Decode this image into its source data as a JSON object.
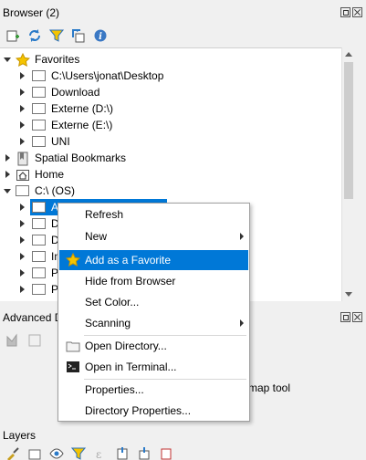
{
  "browser_panel": {
    "title": "Browser (2)",
    "toolbar_icons": [
      "add-layer-icon",
      "refresh-icon",
      "filter-icon",
      "collapse-icon",
      "info-icon"
    ],
    "tree": [
      {
        "label": "Favorites",
        "icon": "star-icon",
        "expanded": true,
        "level": 0
      },
      {
        "label": "C:\\Users\\jonat\\Desktop",
        "icon": "folder-icon",
        "level": 1
      },
      {
        "label": "Download",
        "icon": "folder-icon",
        "level": 1
      },
      {
        "label": "Externe (D:\\)",
        "icon": "folder-icon",
        "level": 1
      },
      {
        "label": "Externe (E:\\)",
        "icon": "folder-icon",
        "level": 1
      },
      {
        "label": "UNI",
        "icon": "folder-icon",
        "level": 1
      },
      {
        "label": "Spatial Bookmarks",
        "icon": "bookmark-icon",
        "level": 0
      },
      {
        "label": "Home",
        "icon": "home-icon",
        "level": 0
      },
      {
        "label": "C:\\ (OS)",
        "icon": "drive-icon",
        "expanded": true,
        "level": 0
      },
      {
        "label": "A",
        "icon": "folder-icon",
        "level": 1,
        "selected": true
      },
      {
        "label": "D",
        "icon": "folder-icon",
        "level": 1
      },
      {
        "label": "D",
        "icon": "folder-icon",
        "level": 1
      },
      {
        "label": "In",
        "icon": "folder-icon",
        "level": 1
      },
      {
        "label": "P",
        "icon": "folder-icon",
        "level": 1
      },
      {
        "label": "P",
        "icon": "folder-icon",
        "level": 1
      }
    ]
  },
  "advanced_panel": {
    "title": "Advanced D",
    "partial_text": "map tool"
  },
  "layers_panel": {
    "title": "Layers"
  },
  "context_menu": {
    "items": [
      {
        "label": "Refresh"
      },
      {
        "label": "New",
        "submenu": true
      },
      {
        "label": "Add as a Favorite",
        "icon": "star-icon",
        "highlighted": true
      },
      {
        "label": "Hide from Browser"
      },
      {
        "label": "Set Color..."
      },
      {
        "label": "Scanning",
        "submenu": true
      },
      {
        "label": "Open Directory...",
        "icon": "folder-icon"
      },
      {
        "label": "Open in Terminal...",
        "icon": "terminal-icon"
      },
      {
        "label": "Properties..."
      },
      {
        "label": "Directory Properties..."
      }
    ]
  },
  "colors": {
    "selection": "#0078d7",
    "star": "#f5c400",
    "panel_bg": "#f0f0f0"
  }
}
